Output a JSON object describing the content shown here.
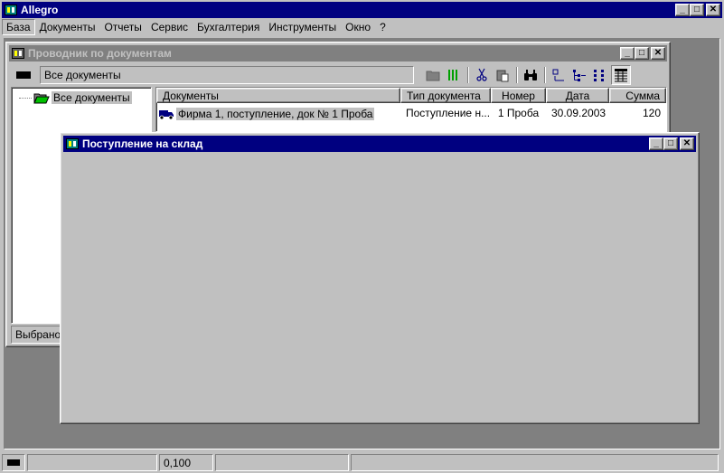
{
  "app": {
    "title": "Allegro",
    "window_buttons": {
      "minimize": "_",
      "maximize": "□",
      "close": "✕"
    }
  },
  "menubar": {
    "items": [
      {
        "label": "База",
        "active": true
      },
      {
        "label": "Документы"
      },
      {
        "label": "Отчеты"
      },
      {
        "label": "Сервис"
      },
      {
        "label": "Бухгалтерия"
      },
      {
        "label": "Инструменты"
      },
      {
        "label": "Окно"
      },
      {
        "label": "?"
      }
    ]
  },
  "explorer": {
    "title": "Проводник по документам",
    "path_value": "Все документы",
    "tree_root": "Все документы",
    "status_text": "Выбрано",
    "columns": [
      "Документы",
      "Тип документа",
      "Номер",
      "Дата",
      "Сумма"
    ],
    "rows": [
      {
        "document": "Фирма 1, поступление, док № 1 Проба",
        "type": "Поступление н...",
        "number": "1 Проба",
        "date": "30.09.2003",
        "sum": "120"
      }
    ]
  },
  "receipt_window": {
    "title": "Поступление на склад"
  },
  "statusbar": {
    "panel2": "",
    "panel3": "0,100",
    "panel4": "",
    "panel5": ""
  },
  "colors": {
    "active_title": "#000080",
    "inactive_title": "#808080",
    "face": "#c0c0c0",
    "mdi_background": "#808080"
  }
}
